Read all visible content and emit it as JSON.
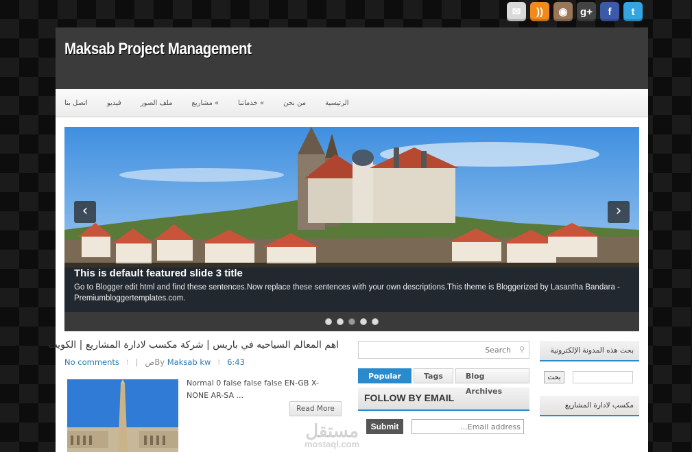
{
  "social": [
    {
      "name": "email-icon",
      "glyph": "✉",
      "color": "#d9d9d9"
    },
    {
      "name": "rss-icon",
      "glyph": "))",
      "color": "#f08a1c"
    },
    {
      "name": "instagram-icon",
      "glyph": "◉",
      "color": "#9a7758"
    },
    {
      "name": "google-plus-icon",
      "glyph": "g+",
      "color": "#444444"
    },
    {
      "name": "facebook-icon",
      "glyph": "f",
      "color": "#3b5ba8"
    },
    {
      "name": "twitter-icon",
      "glyph": "t",
      "color": "#33a5e0"
    }
  ],
  "header": {
    "title": "Maksab Project Management"
  },
  "nav": {
    "items": [
      "اتصل بنا",
      "فيديو",
      "ملف الصور",
      "مشاريع «",
      "خدماتنا «",
      "من نحن",
      "الرئيسية"
    ]
  },
  "slider": {
    "title": "This is default featured slide 3 title",
    "description": "Go to Blogger edit html and find these sentences.Now replace these sentences with your own descriptions.This theme is Bloggerized by Lasantha Bandara - Premiumbloggertemplates.com.",
    "prev": "‹",
    "next": "›",
    "slide_count": 5,
    "active_slide": 3
  },
  "post": {
    "title": "اهم المعالم السياحيه في باريس | شركة مكسب لادارة المشاريع | الكويت",
    "comments": "No comments",
    "author_prefix": "صBy",
    "author": "Maksab kw",
    "time": "6:43",
    "excerpt": "Normal 0 false false false EN-GB X-NONE AR-SA ...",
    "read_more": "Read More"
  },
  "watermark": {
    "line1": "مستقل",
    "line2": "mostaql.com"
  },
  "search": {
    "placeholder": "Search",
    "icon": "search-icon"
  },
  "tabs": [
    "Popular",
    "Tags",
    "Blog Archives"
  ],
  "follow": {
    "title": "FOLLOW BY EMAIL",
    "submit": "Submit",
    "placeholder": "...Email address"
  },
  "sidebar": {
    "search_title": "بحث هذه المدونة الإلكترونية",
    "search_button": "بحث",
    "widget2_title": "مكسب لادارة المشاريع"
  }
}
